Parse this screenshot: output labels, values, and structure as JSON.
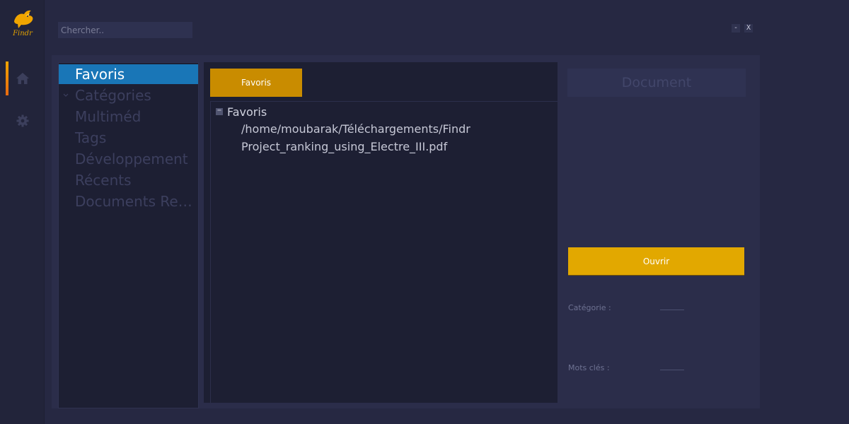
{
  "app": {
    "logo_text": "Findr"
  },
  "rail": {
    "items": [
      {
        "icon": "home-icon",
        "active": true
      },
      {
        "icon": "gear-icon",
        "active": false
      }
    ]
  },
  "search": {
    "placeholder": "Chercher.."
  },
  "window": {
    "minimize_label": "-",
    "close_label": "X"
  },
  "sidebar": {
    "items": [
      {
        "label": "Favoris",
        "active": true
      },
      {
        "label": "Catégories",
        "expandable": true
      },
      {
        "label": "Multiméd"
      },
      {
        "label": "Tags"
      },
      {
        "label": "Développement"
      },
      {
        "label": "Récents"
      },
      {
        "label": "Documents Rec..."
      }
    ]
  },
  "main": {
    "tab_label": "Favoris",
    "tree": {
      "root_label": "Favoris",
      "toggle": "−",
      "children": [
        "/home/moubarak/Téléchargements/Findr",
        "Project_ranking_using_Electre_III.pdf"
      ]
    }
  },
  "detail": {
    "title": "Document",
    "dots": [
      "..........................................................................................................",
      "..........................................................................................................",
      "..........................................................................................................",
      "..........................................................................................................",
      ".........................................................................................................."
    ],
    "open_label": "Ouvrir",
    "category_label": "Catégorie :",
    "keywords_label": "Mots clés :"
  },
  "colors": {
    "background": "#262842",
    "panel": "#1d1f33",
    "accent": "#e2a800",
    "tab": "#c98c00",
    "selection": "#1976b7"
  }
}
